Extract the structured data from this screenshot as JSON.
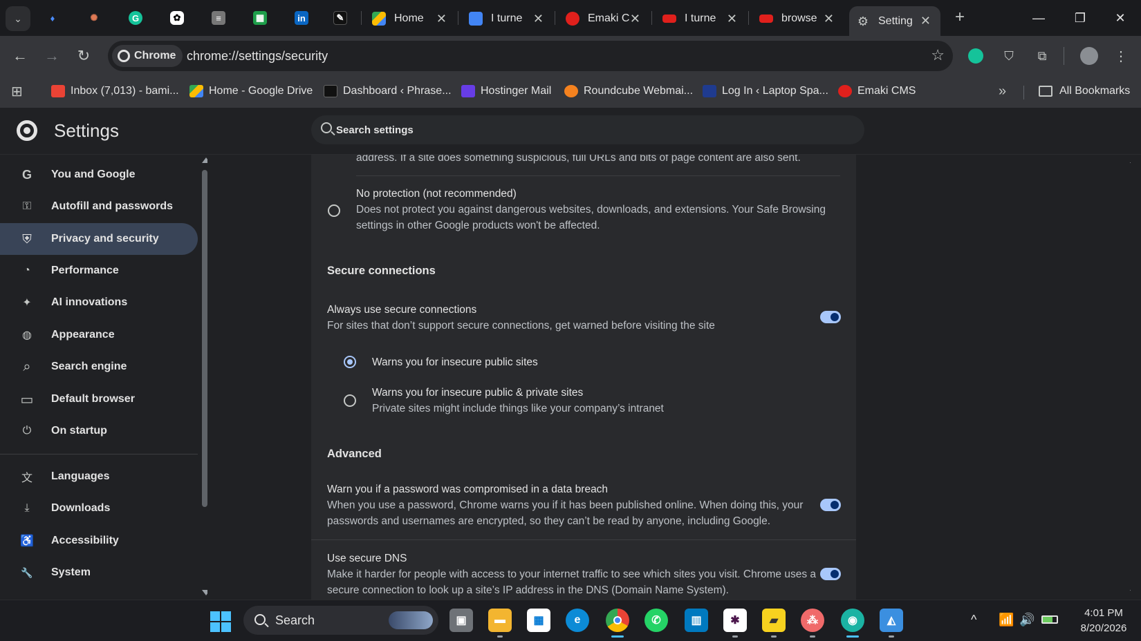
{
  "window": {
    "pinned_tabs": [
      "diamond-app",
      "claude",
      "grammarly",
      "chatgpt",
      "reader",
      "sheets",
      "linkedin",
      "phrase"
    ],
    "tabs": [
      {
        "title": "Home",
        "favicon_color": "#34a853"
      },
      {
        "title": "I turne",
        "favicon_color": "#4285f4"
      },
      {
        "title": "Emaki C",
        "favicon_color": "#e0201c"
      },
      {
        "title": "I turne",
        "favicon_color": "#e0201c"
      },
      {
        "title": "browse",
        "favicon_color": "#e0201c"
      },
      {
        "title": "Setting",
        "favicon_color": "#c4c7c5"
      }
    ],
    "active_tab_index": 5,
    "controls": {
      "new_tab": "+",
      "minimize": "—",
      "restore": "❐",
      "close": "✕"
    }
  },
  "toolbar": {
    "back": "←",
    "forward": "→",
    "reload": "↻",
    "chip_label": "Chrome",
    "url": "chrome://settings/security",
    "star": "☆",
    "menu": "⋮"
  },
  "bookmarks": {
    "apps_icon": "apps-grid-icon",
    "items": [
      {
        "label": "Inbox (7,013) - bami...",
        "color": "#ea4335"
      },
      {
        "label": "Home - Google Drive",
        "color": "#34a853"
      },
      {
        "label": "Dashboard ‹ Phrase...",
        "color": "#111111"
      },
      {
        "label": "Hostinger Mail",
        "color": "#673de6"
      },
      {
        "label": "Roundcube Webmai...",
        "color": "#f5821f"
      },
      {
        "label": "Log In ‹ Laptop Spa...",
        "color": "#1f3b8f"
      },
      {
        "label": "Emaki CMS",
        "color": "#e0201c"
      }
    ],
    "overflow": "»",
    "all_bookmarks": "All Bookmarks"
  },
  "settings": {
    "title": "Settings",
    "search_placeholder": "Search settings"
  },
  "sidebar": {
    "items": [
      {
        "label": "You and Google",
        "icon": "google-g-icon",
        "glyph": "G"
      },
      {
        "label": "Autofill and passwords",
        "icon": "key-icon",
        "glyph": "⚿"
      },
      {
        "label": "Privacy and security",
        "icon": "shield-icon",
        "glyph": "⛨",
        "active": true
      },
      {
        "label": "Performance",
        "icon": "speedometer-icon",
        "glyph": "◔"
      },
      {
        "label": "AI innovations",
        "icon": "sparkle-icon",
        "glyph": "✦"
      },
      {
        "label": "Appearance",
        "icon": "palette-icon",
        "glyph": "◍"
      },
      {
        "label": "Search engine",
        "icon": "search-icon",
        "glyph": "⌕"
      },
      {
        "label": "Default browser",
        "icon": "browser-window-icon",
        "glyph": "▭"
      },
      {
        "label": "On startup",
        "icon": "power-icon",
        "glyph": "⏻"
      },
      {
        "label": "Languages",
        "icon": "translate-icon",
        "glyph": "文"
      },
      {
        "label": "Downloads",
        "icon": "download-icon",
        "glyph": "⤓"
      },
      {
        "label": "Accessibility",
        "icon": "accessibility-icon",
        "glyph": "♿"
      },
      {
        "label": "System",
        "icon": "wrench-icon",
        "glyph": "🔧"
      }
    ]
  },
  "content": {
    "top_fragment": "address. If a site does something suspicious, full URLs and bits of page content are also sent.",
    "no_protection": {
      "title": "No protection (not recommended)",
      "desc_line1": "Does not protect you against dangerous websites, downloads, and extensions. Your Safe Browsing",
      "desc_line2": "settings in other Google products won't be affected.",
      "selected": false
    },
    "secure_connections": {
      "heading": "Secure connections",
      "always_title": "Always use secure connections",
      "always_desc": "For sites that don’t support secure connections, get warned before visiting the site",
      "always_enabled": true,
      "options": [
        {
          "title": "Warns you for insecure public sites",
          "desc": "",
          "selected": true
        },
        {
          "title": "Warns you for insecure public & private sites",
          "desc": "Private sites might include things like your company’s intranet",
          "selected": false
        }
      ]
    },
    "advanced": {
      "heading": "Advanced",
      "breach": {
        "title": "Warn you if a password was compromised in a data breach",
        "desc_line1": "When you use a password, Chrome warns you if it has been published online. When doing this, your",
        "desc_line2": "passwords and usernames are encrypted, so they can’t be read by anyone, including Google.",
        "enabled": true
      },
      "dns": {
        "title": "Use secure DNS",
        "desc_line1": "Make it harder for people with access to your internet traffic to see which sites you visit. Chrome uses a",
        "desc_line2": "secure connection to look up a site’s IP address in the DNS (Domain Name System).",
        "enabled": true
      }
    }
  },
  "taskbar": {
    "search_label": "Search",
    "apps": [
      "task-view",
      "file-explorer",
      "microsoft-store",
      "edge",
      "chrome",
      "whatsapp",
      "trello",
      "slack",
      "sticky-notes",
      "asana",
      "signal-app",
      "photos"
    ],
    "clock_time": "4:01 PM",
    "clock_date": "8/20/2026",
    "tray": {
      "chevron": "^",
      "wifi": "📶",
      "volume": "🔊"
    }
  }
}
